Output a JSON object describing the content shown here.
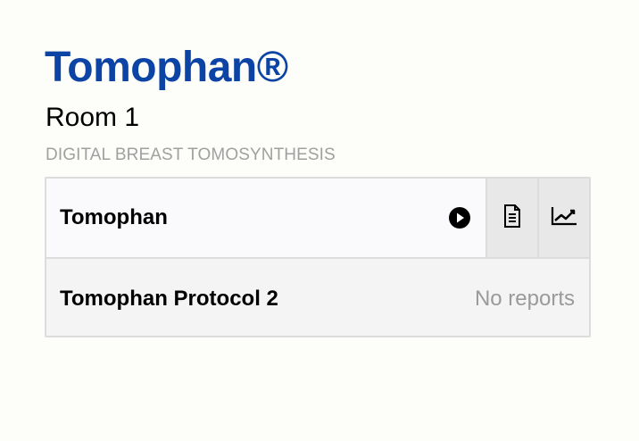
{
  "header": {
    "brand": "Tomophan®",
    "room": "Room 1",
    "modality": "DIGITAL BREAST TOMOSYNTHESIS"
  },
  "rows": [
    {
      "title": "Tomophan",
      "actions": [
        "play-icon",
        "document-icon",
        "trend-chart-icon"
      ]
    },
    {
      "title": "Tomophan Protocol 2",
      "status": "No reports"
    }
  ],
  "colors": {
    "brand": "#0c44a6",
    "subtitle": "#a0a0a0",
    "muted_status": "#9a9a9a",
    "panel_border": "#dcdcdc",
    "button_bg": "#e8e8e8"
  }
}
